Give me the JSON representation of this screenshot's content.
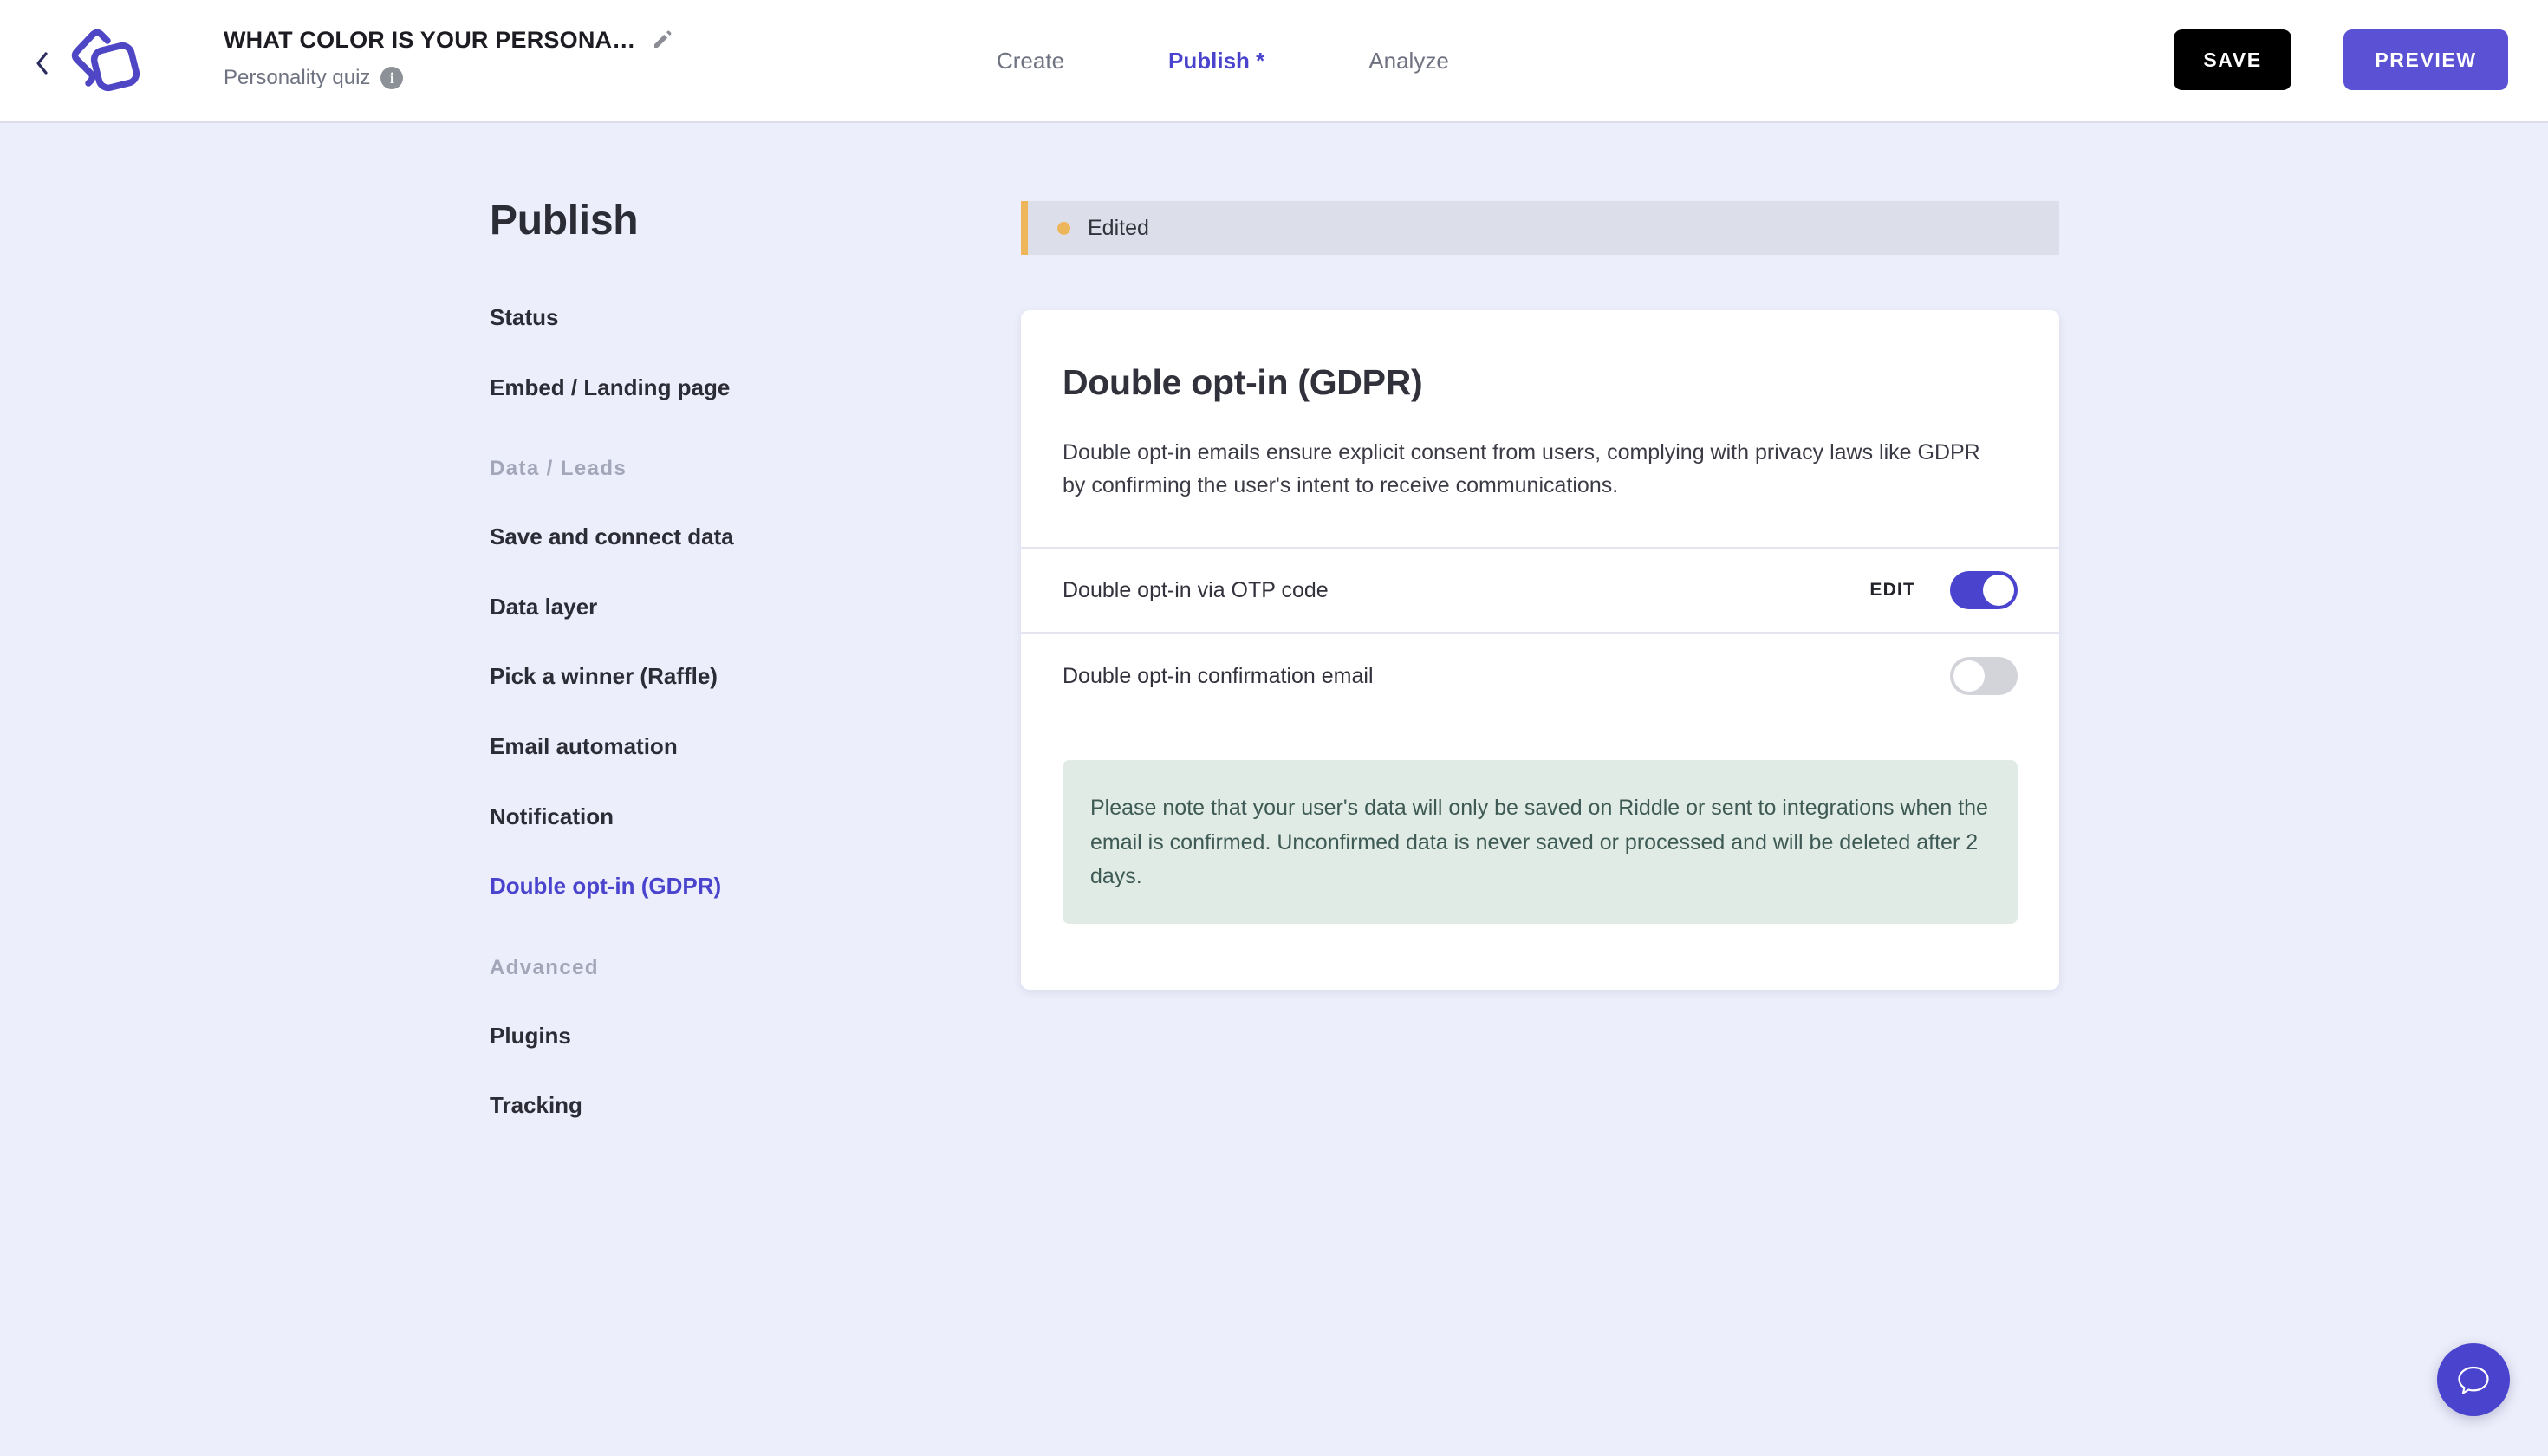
{
  "header": {
    "back_icon": "chevron-left-icon",
    "logo_icon": "riddle-logo",
    "quiz_title": "WHAT COLOR IS YOUR PERSONALI…",
    "edit_title_icon": "pencil-icon",
    "quiz_type": "Personality quiz",
    "info_icon": "info-icon",
    "info_glyph": "i",
    "tabs": [
      {
        "label": "Create",
        "active": false
      },
      {
        "label": "Publish *",
        "active": true
      },
      {
        "label": "Analyze",
        "active": false
      }
    ],
    "save_label": "SAVE",
    "preview_label": "PREVIEW"
  },
  "sidebar": {
    "heading": "Publish",
    "items": [
      {
        "label": "Status",
        "type": "item",
        "current": false
      },
      {
        "label": "Embed / Landing page",
        "type": "item",
        "current": false
      },
      {
        "label": "Data / Leads",
        "type": "group"
      },
      {
        "label": "Save and connect data",
        "type": "item",
        "current": false
      },
      {
        "label": "Data layer",
        "type": "item",
        "current": false
      },
      {
        "label": "Pick a winner (Raffle)",
        "type": "item",
        "current": false
      },
      {
        "label": "Email automation",
        "type": "item",
        "current": false
      },
      {
        "label": "Notification",
        "type": "item",
        "current": false
      },
      {
        "label": "Double opt-in (GDPR)",
        "type": "item",
        "current": true
      },
      {
        "label": "Advanced",
        "type": "group"
      },
      {
        "label": "Plugins",
        "type": "item",
        "current": false
      },
      {
        "label": "Tracking",
        "type": "item",
        "current": false
      }
    ]
  },
  "main": {
    "status_banner": {
      "text": "Edited",
      "dot_color": "#eeb65a",
      "accent_color": "#eeb65a",
      "background": "#dcdee9"
    },
    "card": {
      "title": "Double opt-in (GDPR)",
      "description": "Double opt-in emails ensure explicit consent from users, complying with privacy laws like GDPR by confirming the user's intent to receive communications.",
      "rows": [
        {
          "label": "Double opt-in via OTP code",
          "edit_label": "EDIT",
          "has_edit": true,
          "enabled": true
        },
        {
          "label": "Double opt-in confirmation email",
          "edit_label": "",
          "has_edit": false,
          "enabled": false
        }
      ],
      "note": "Please note that your user's data will only be saved on Riddle or sent to integrations when the email is confirmed. Unconfirmed data is never saved or processed and will be deleted after 2 days."
    }
  },
  "chat": {
    "icon": "chat-bubble-icon"
  },
  "colors": {
    "accent": "#4a43cd",
    "preview_button": "#5b51d4",
    "page_background": "#eceefb",
    "note_background": "#dfebe4",
    "note_text": "#3f5a55",
    "warning": "#eeb65a"
  }
}
